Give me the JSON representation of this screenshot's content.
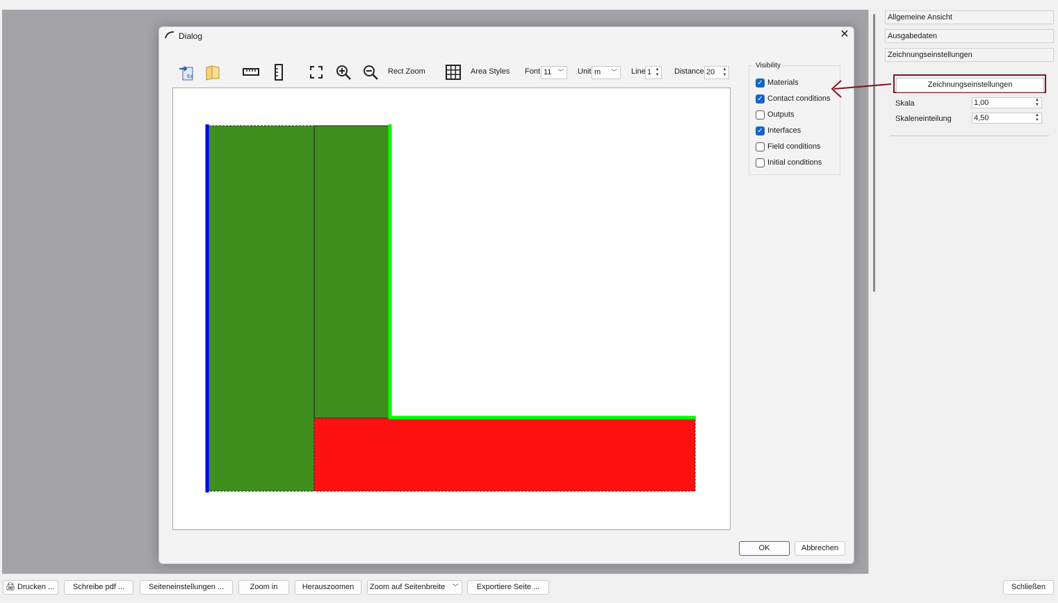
{
  "dialog": {
    "title": "Dialog",
    "toolbar": {
      "rect_zoom": "Rect Zoom",
      "area_styles": "Area Styles",
      "font_label": "Font",
      "font_value": "11",
      "unit_label": "Unit",
      "unit_value": "m",
      "line_label": "Line",
      "line_value": "1",
      "distance_label": "Distance",
      "distance_value": "20"
    },
    "visibility": {
      "title": "Visibility",
      "items": [
        {
          "label": "Materials",
          "checked": true
        },
        {
          "label": "Contact conditions",
          "checked": true
        },
        {
          "label": "Outputs",
          "checked": false
        },
        {
          "label": "Interfaces",
          "checked": true
        },
        {
          "label": "Field conditions",
          "checked": false
        },
        {
          "label": "Initial conditions",
          "checked": false
        }
      ]
    },
    "ok_label": "OK",
    "cancel_label": "Abbrechen"
  },
  "right_panel": {
    "sections": [
      "Allgemeine Ansicht",
      "Ausgabedaten",
      "Zeichnungseinstellungen"
    ],
    "drawing_settings_button": "Zeichnungseinstellungen",
    "scale_label": "Skala",
    "scale_value": "1,00",
    "scale_division_label": "Skaleneinteilung",
    "scale_division_value": "4,50"
  },
  "bottom_bar": {
    "print": "Drucken ...",
    "write_pdf": "Schreibe pdf ...",
    "page_settings": "Seiteneinstellungen ...",
    "zoom_in": "Zoom in",
    "zoom_out": "Herauszoomen",
    "zoom_page_width": "Zoom auf Seitenbreite",
    "export_page": "Exportiere Seite ...",
    "close": "Schließen"
  },
  "colors": {
    "material_green": "#3f8f1f",
    "material_red": "#ff1111",
    "contact_blue": "#0000ff",
    "interface_green": "#00ff00",
    "highlight_red": "#7b1521",
    "checkbox_blue": "#1565c0"
  },
  "icons": [
    "import-icon",
    "folder-icon",
    "horizontal-ruler-icon",
    "vertical-ruler-icon",
    "fit-to-view-icon",
    "zoom-in-icon",
    "zoom-out-icon",
    "grid-icon",
    "close-icon",
    "printer-icon",
    "chevron-down-icon"
  ]
}
